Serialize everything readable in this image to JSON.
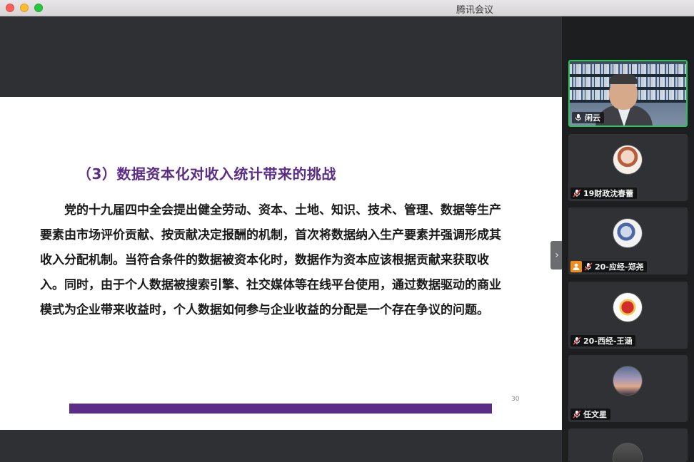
{
  "window": {
    "title": "腾讯会议"
  },
  "slide": {
    "title": "（3）数据资本化对收入统计带来的挑战",
    "body": "党的十九届四中全会提出健全劳动、资本、土地、知识、技术、管理、数据等生产要素由市场评价贡献、按贡献决定报酬的机制，首次将数据纳入生产要素并强调形成其收入分配机制。当符合条件的数据被资本化时，数据作为资本应该根据贡献来获取收入。同时，由于个人数据被搜索引擎、社交媒体等在线平台使用，通过数据驱动的商业模式为企业带来收益时，个人数据如何参与企业收益的分配是一个存在争议的问题。",
    "page_number": "30",
    "accent_color": "#5b2d86"
  },
  "sidebar": {
    "collapse_glyph": "›",
    "participants": [
      {
        "name": "闲云",
        "mic": "on",
        "speaking": true
      },
      {
        "name": "19财政沈春蕾",
        "mic": "muted"
      },
      {
        "name": "20-应经-郑尧",
        "mic": "muted",
        "role_icon": "host-icon"
      },
      {
        "name": "20-西经-王涵",
        "mic": "muted"
      },
      {
        "name": "任文星",
        "mic": "muted"
      }
    ]
  }
}
